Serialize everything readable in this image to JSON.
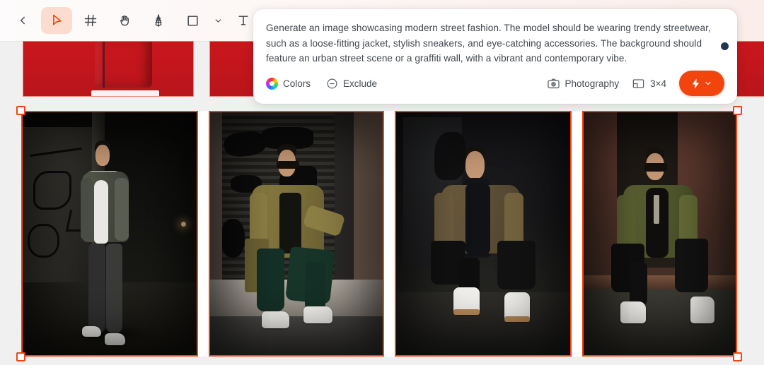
{
  "app": {
    "accent_color": "#f2450d",
    "toolbar_bg": "#fdf6f4",
    "canvas_bg": "#f0f0f0"
  },
  "toolbar": {
    "items": [
      {
        "name": "back-button",
        "icon": "chevron-left-icon",
        "label": "Back",
        "active": false
      },
      {
        "name": "select-tool",
        "icon": "cursor-arrow-icon",
        "label": "Select",
        "active": true
      },
      {
        "name": "frame-tool",
        "icon": "grid-hash-icon",
        "label": "Frame",
        "active": false
      },
      {
        "name": "hand-tool",
        "icon": "hand-icon",
        "label": "Hand",
        "active": false
      },
      {
        "name": "pen-tool",
        "icon": "pen-nib-icon",
        "label": "Pen",
        "active": false
      },
      {
        "name": "shape-tool",
        "icon": "square-icon",
        "label": "Shape",
        "active": false
      },
      {
        "name": "shape-dropdown",
        "icon": "chevron-down-icon",
        "label": "Shape options",
        "active": false
      },
      {
        "name": "text-tool",
        "icon": "text-t-icon",
        "label": "Text",
        "active": false
      }
    ]
  },
  "prompt_panel": {
    "text": "Generate an image showcasing modern street fashion. The model should be wearing trendy streetwear, such as a loose-fitting jacket, stylish sneakers, and eye-catching accessories. The background should feature an urban street scene or a graffiti wall, with a vibrant and contemporary vibe.",
    "controls": {
      "colors_label": "Colors",
      "exclude_label": "Exclude",
      "style_label": "Photography",
      "aspect_ratio_label": "3×4",
      "generate_label": ""
    }
  },
  "top_strip": {
    "thumbnails": [
      {
        "name": "thumbnail-1",
        "description": "red background with denim jacket"
      },
      {
        "name": "thumbnail-2",
        "description": "red background"
      },
      {
        "name": "thumbnail-3",
        "description": "red background partial"
      }
    ]
  },
  "results": {
    "selected": true,
    "images": [
      {
        "name": "result-image-1",
        "alt": "Man standing in dark alley wearing olive jacket, white tee, dark joggers and white sneakers in front of a graffiti wall"
      },
      {
        "name": "result-image-2",
        "alt": "Man with sunglasses sitting on a curb wearing khaki jacket, dark green pants and white sneakers in front of a graffiti shutter"
      },
      {
        "name": "result-image-3",
        "alt": "Man crouching in dark setting wearing olive jacket over black hoodie, black pants and white gum-sole sneakers"
      },
      {
        "name": "result-image-4",
        "alt": "Man with sunglasses crouching in a doorway wearing olive bomber jacket, black jeans and white sneakers"
      }
    ],
    "handles": [
      "top-left",
      "top-right",
      "bottom-left",
      "bottom-right"
    ]
  }
}
